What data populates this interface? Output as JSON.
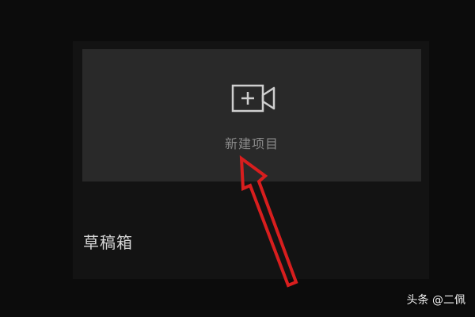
{
  "new_project": {
    "label": "新建项目",
    "icon": "video-camera-plus-icon"
  },
  "drafts": {
    "title": "草稿箱"
  },
  "annotation": {
    "arrow_color": "#d81e1e"
  },
  "watermark": {
    "text": "头条 @二佩"
  },
  "colors": {
    "background": "#0c0c0c",
    "panel": "#131313",
    "card": "#292929",
    "icon": "#cfcfcf",
    "label": "#8a8a8a",
    "title": "#d6d6d6"
  }
}
